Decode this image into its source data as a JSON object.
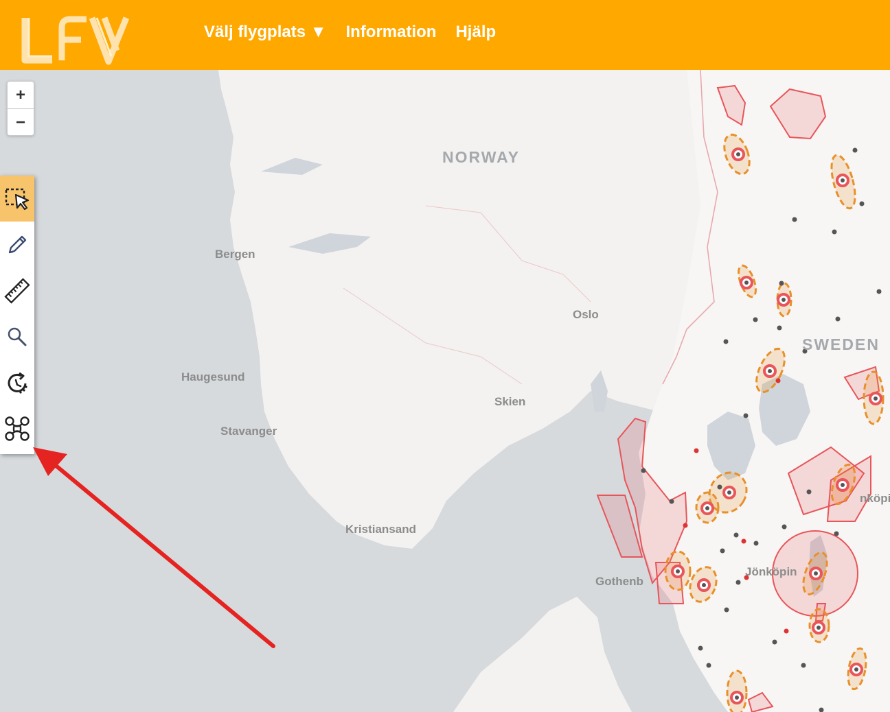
{
  "header": {
    "logo_text": "LFV",
    "nav": {
      "airport": "Välj flygplats ▼",
      "info": "Information",
      "help": "Hjälp"
    }
  },
  "zoom": {
    "in": "+",
    "out": "−"
  },
  "toolbar": {
    "tools": [
      "select-icon",
      "pencil-icon",
      "ruler-icon",
      "magnifier-icon",
      "timer-icon",
      "drone-icon"
    ],
    "active_tool": "select-icon"
  },
  "map": {
    "countries": {
      "norway": "NORWAY",
      "sweden": "SWEDEN"
    },
    "cities": {
      "bergen": "Bergen",
      "oslo": "Oslo",
      "haugesund": "Haugesund",
      "stavanger": "Stavanger",
      "skien": "Skien",
      "kristiansand": "Kristiansand",
      "gothenburg": "Gothenb",
      "jonkoping": "Jönköpin",
      "linkoping": "nköpi"
    }
  },
  "colors": {
    "header": "#ffa800",
    "active_tool": "#f7c46b",
    "restricted_zone": "#e8555a",
    "airport_zone": "#e8902a",
    "annotation_arrow": "#e52320"
  }
}
